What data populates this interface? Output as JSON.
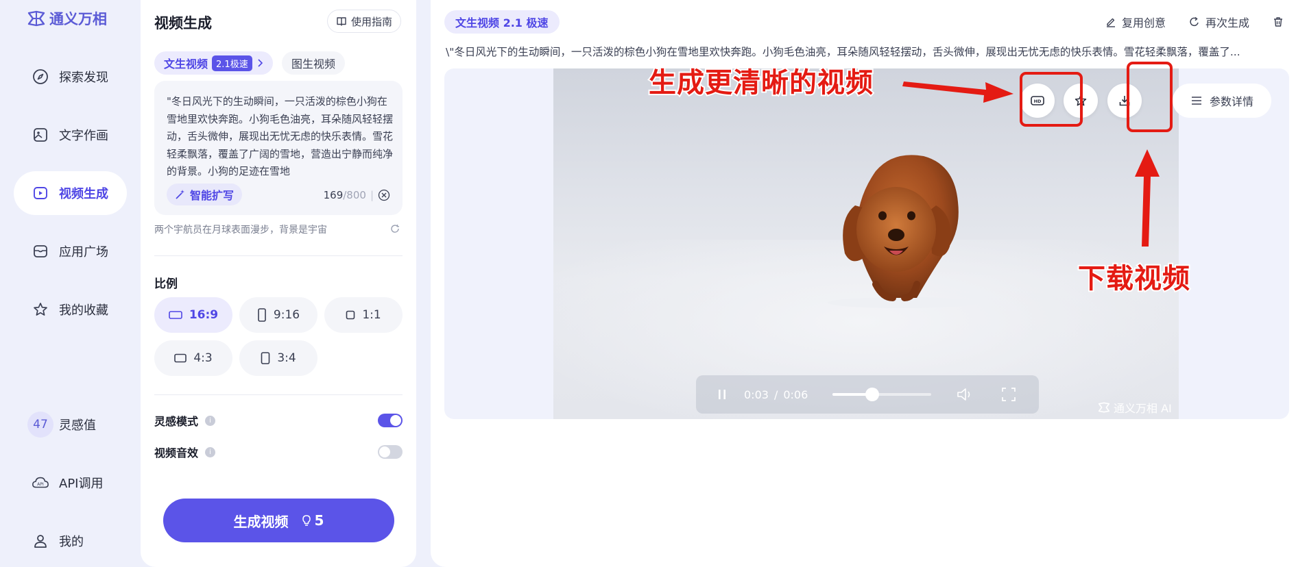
{
  "app": {
    "name": "通义万相"
  },
  "sidebar": {
    "items": [
      {
        "label": "探索发现",
        "icon": "compass-icon"
      },
      {
        "label": "文字作画",
        "icon": "image-icon"
      },
      {
        "label": "视频生成",
        "icon": "video-icon",
        "active": true
      },
      {
        "label": "应用广场",
        "icon": "store-icon"
      },
      {
        "label": "我的收藏",
        "icon": "star-icon"
      }
    ],
    "inspiration": {
      "value": "47",
      "label": "灵感值"
    },
    "api": {
      "label": "API调用"
    },
    "me": {
      "label": "我的"
    }
  },
  "panel": {
    "title": "视频生成",
    "guide_label": "使用指南",
    "tab_text_video": "文生视频",
    "tab_text_video_tag": "2.1极速",
    "tab_image_video": "图生视频",
    "prompt_text": "\"冬日风光下的生动瞬间，一只活泼的棕色小狗在雪地里欢快奔跑。小狗毛色油亮，耳朵随风轻轻摆动，舌头微伸，展现出无忧无虑的快乐表情。雪花轻柔飘落，覆盖了广阔的雪地，营造出宁静而纯净的背景。小狗的足迹在雪地",
    "expand_label": "智能扩写",
    "char_count": "169",
    "char_max": "/800",
    "suggestion": "两个宇航员在月球表面漫步，背景是宇宙",
    "ratio_label": "比例",
    "ratios": [
      "16:9",
      "9:16",
      "1:1",
      "4:3",
      "3:4"
    ],
    "inspiration_mode": {
      "label": "灵感模式",
      "on": true
    },
    "video_sound": {
      "label": "视频音效",
      "on": false
    },
    "generate_label": "生成视频",
    "generate_cost": "5"
  },
  "main": {
    "tag": "文生视频 2.1 极速",
    "reuse_label": "复用创意",
    "regenerate_label": "再次生成",
    "prompt_line": "\\\"冬日风光下的生动瞬间，一只活泼的棕色小狗在雪地里欢快奔跑。小狗毛色油亮，耳朵随风轻轻摆动，舌头微伸，展现出无忧无虑的快乐表情。雪花轻柔飘落，覆盖了...",
    "params_label": "参数详情",
    "player": {
      "current": "0:03",
      "separator": "/",
      "duration": "0:06",
      "progress": 0.4
    },
    "watermark": "通义万相 AI"
  },
  "annotations": {
    "hd_note": "生成更清晰的视频",
    "download_note": "下载视频"
  },
  "colors": {
    "accent": "#5b54e8",
    "annotation": "#e41b13"
  }
}
